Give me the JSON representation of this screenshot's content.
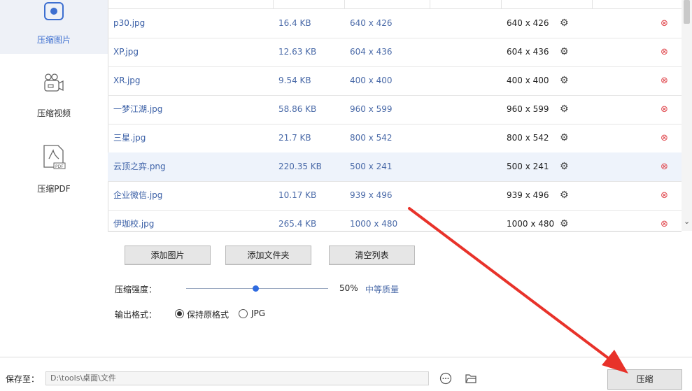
{
  "sidebar": {
    "items": [
      {
        "label": "压缩图片",
        "icon": "image-icon",
        "active": true
      },
      {
        "label": "压缩视频",
        "icon": "video-camera-icon",
        "active": false
      },
      {
        "label": "压缩PDF",
        "icon": "pdf-file-icon",
        "active": false
      }
    ]
  },
  "files": [
    {
      "name": "p30.jpg",
      "size": "16.4 KB",
      "dimensions": "640 x 426",
      "output": "640 x 426",
      "selected": false
    },
    {
      "name": "XP.jpg",
      "size": "12.63 KB",
      "dimensions": "604 x 436",
      "output": "604 x 436",
      "selected": false
    },
    {
      "name": "XR.jpg",
      "size": "9.54 KB",
      "dimensions": "400 x 400",
      "output": "400 x 400",
      "selected": false
    },
    {
      "name": "一梦江湖.jpg",
      "size": "58.86 KB",
      "dimensions": "960 x 599",
      "output": "960 x 599",
      "selected": false
    },
    {
      "name": "三星.jpg",
      "size": "21.7 KB",
      "dimensions": "800 x 542",
      "output": "800 x 542",
      "selected": false
    },
    {
      "name": "云顶之弈.png",
      "size": "220.35 KB",
      "dimensions": "500 x 241",
      "output": "500 x 241",
      "selected": true
    },
    {
      "name": "企业微信.jpg",
      "size": "10.17 KB",
      "dimensions": "939 x 496",
      "output": "939 x 496",
      "selected": false
    },
    {
      "name": "伊珈校.jpg",
      "size": "265.4 KB",
      "dimensions": "1000 x 480",
      "output": "1000 x 480",
      "selected": false
    }
  ],
  "actions": {
    "add_image": "添加图片",
    "add_folder": "添加文件夹",
    "clear_list": "清空列表"
  },
  "compression": {
    "label": "压缩强度：",
    "level_percent": 50,
    "value_text": "50%",
    "quality_text": "中等质量"
  },
  "output_format": {
    "label": "输出格式：",
    "options": [
      {
        "label": "保持原格式",
        "selected": true
      },
      {
        "label": "JPG",
        "selected": false
      }
    ]
  },
  "footer": {
    "save_label": "保存至：",
    "save_path": "D:\\tools\\桌面\\文件",
    "compress_button": "压缩"
  },
  "colors": {
    "accent": "#2f6be0",
    "delete": "#e0484e",
    "annotation_arrow": "#e8322a"
  }
}
